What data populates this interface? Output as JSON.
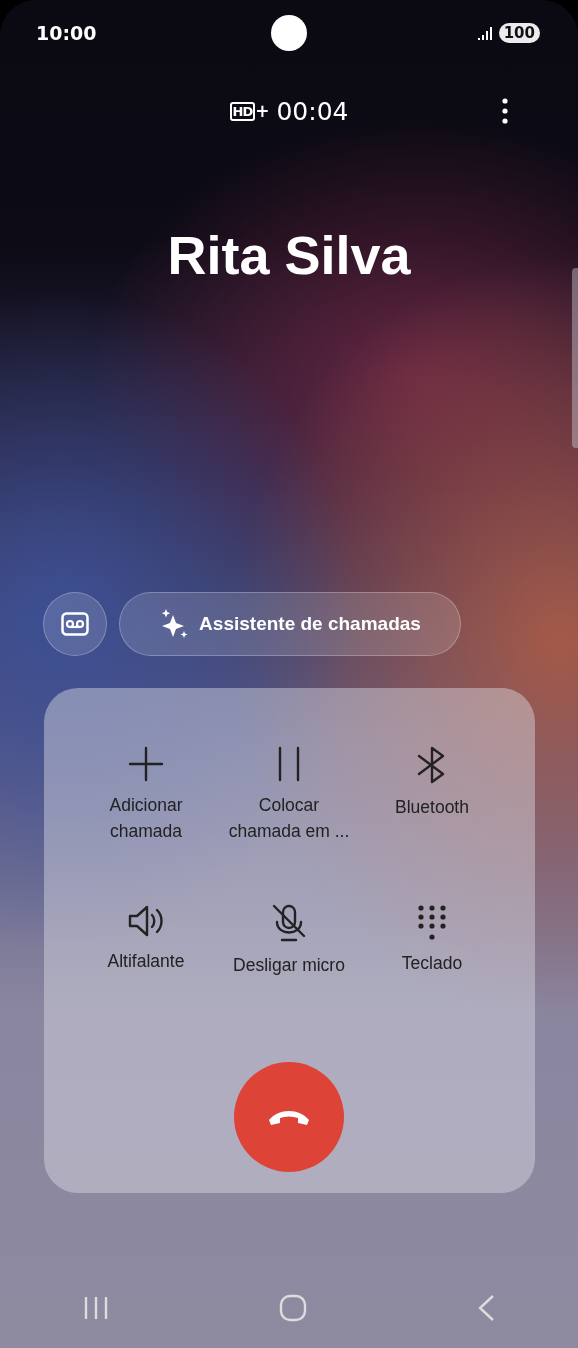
{
  "status_bar": {
    "time": "10:00",
    "battery": "100"
  },
  "call": {
    "quality": "HD+",
    "duration": "00:04",
    "contact": "Rita Silva"
  },
  "assistant_button": {
    "label": "Assistente de chamadas"
  },
  "actions": [
    {
      "label": "Adicionar\nchamada"
    },
    {
      "label": "Colocar\nchamada em ..."
    },
    {
      "label": "Bluetooth"
    },
    {
      "label": "Altifalante"
    },
    {
      "label": "Desligar micro"
    },
    {
      "label": "Teclado"
    }
  ]
}
